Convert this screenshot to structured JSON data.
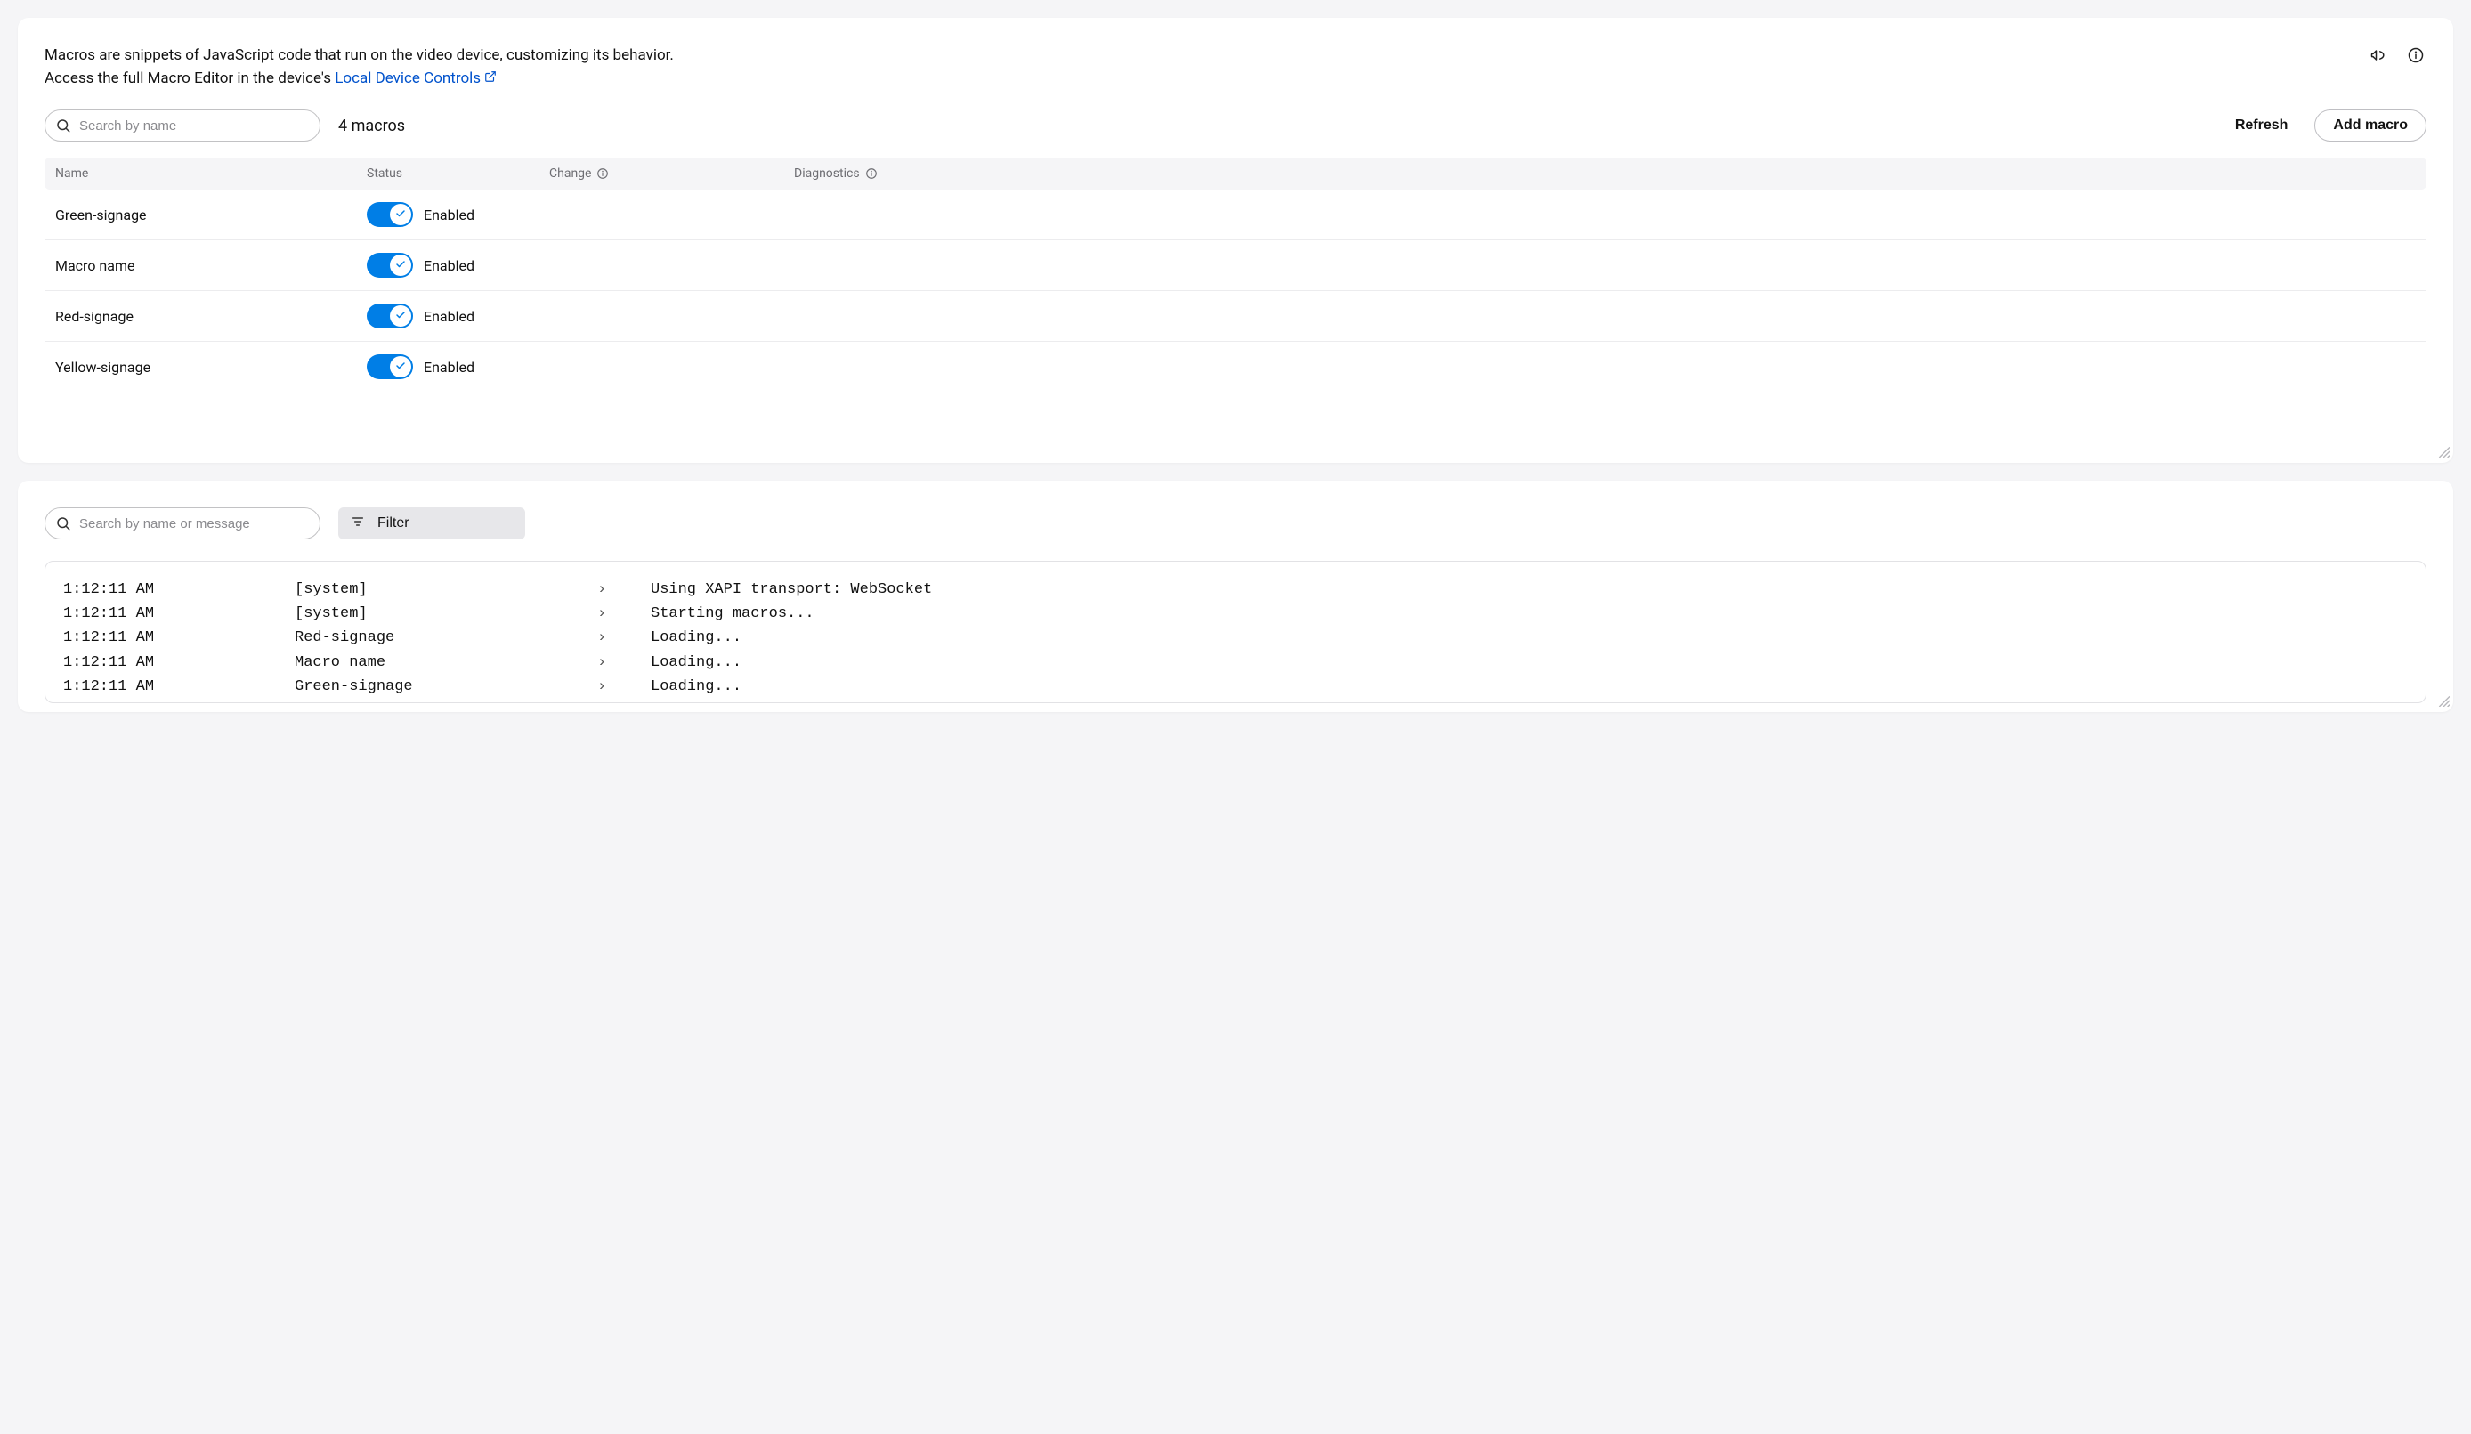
{
  "header": {
    "desc_line1": "Macros are snippets of JavaScript code that run on the video device, customizing its behavior.",
    "desc_line2_prefix": "Access the full Macro Editor in the device's ",
    "link_text": "Local Device Controls"
  },
  "toolbar": {
    "search_placeholder": "Search by name",
    "count_text": "4 macros",
    "refresh_label": "Refresh",
    "add_label": "Add macro"
  },
  "columns": {
    "name": "Name",
    "status": "Status",
    "change": "Change",
    "diagnostics": "Diagnostics"
  },
  "status_label": "Enabled",
  "rows": [
    {
      "name": "Green-signage"
    },
    {
      "name": "Macro name"
    },
    {
      "name": "Red-signage"
    },
    {
      "name": "Yellow-signage"
    }
  ],
  "log_toolbar": {
    "search_placeholder": "Search by name or message",
    "filter_label": "Filter"
  },
  "logs": [
    {
      "time": "1:12:11 AM",
      "source": "[system]",
      "msg": "Using XAPI transport: WebSocket"
    },
    {
      "time": "1:12:11 AM",
      "source": "[system]",
      "msg": "Starting macros..."
    },
    {
      "time": "1:12:11 AM",
      "source": "Red-signage",
      "msg": "Loading..."
    },
    {
      "time": "1:12:11 AM",
      "source": "Macro name",
      "msg": "Loading..."
    },
    {
      "time": "1:12:11 AM",
      "source": "Green-signage",
      "msg": "Loading..."
    }
  ]
}
